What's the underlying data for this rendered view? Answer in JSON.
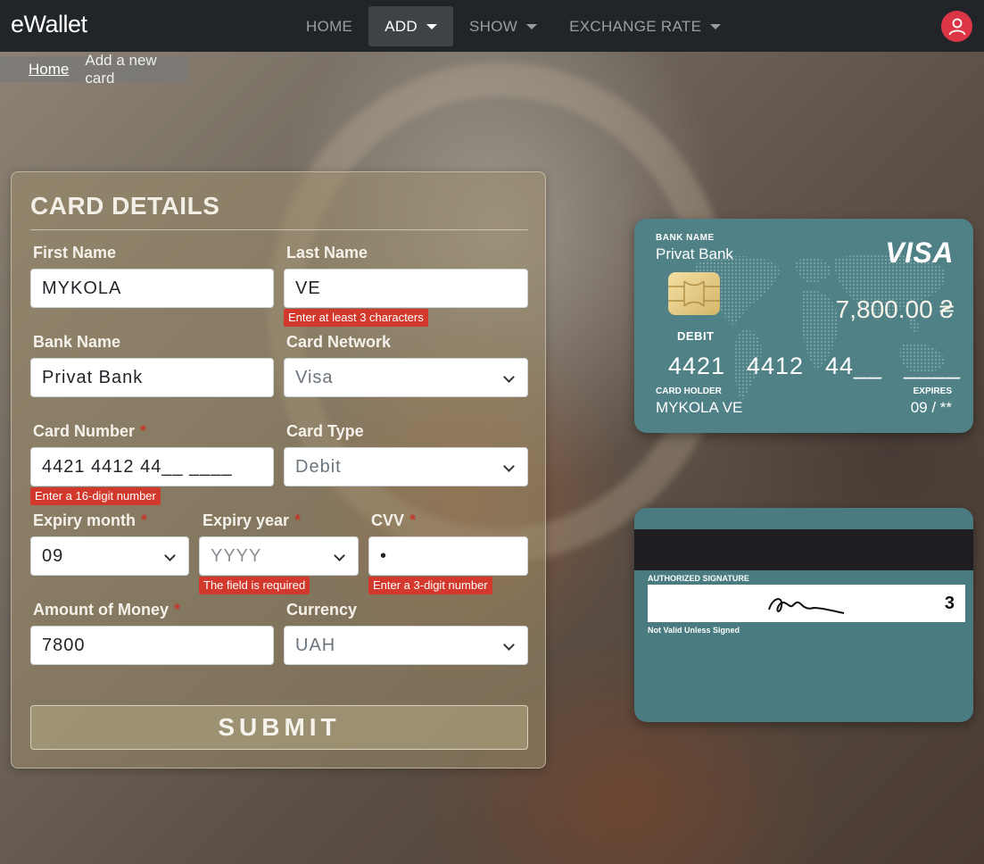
{
  "navbar": {
    "brand": "eWallet",
    "items": [
      {
        "label": "HOME",
        "dropdown": false,
        "active": false
      },
      {
        "label": "ADD",
        "dropdown": true,
        "active": true
      },
      {
        "label": "SHOW",
        "dropdown": true,
        "active": false
      },
      {
        "label": "EXCHANGE RATE",
        "dropdown": true,
        "active": false
      }
    ],
    "avatar_icon": "user-icon"
  },
  "breadcrumb": {
    "home": "Home",
    "current": "Add a new card"
  },
  "form": {
    "title": "CARD DETAILS",
    "first_name": {
      "label": "First Name",
      "value": "MYKOLA"
    },
    "last_name": {
      "label": "Last Name",
      "value": "VE",
      "error": "Enter at least 3 characters"
    },
    "bank_name": {
      "label": "Bank Name",
      "value": "Privat Bank"
    },
    "card_network": {
      "label": "Card Network",
      "value": "Visa"
    },
    "card_number": {
      "label": "Card Number",
      "required_mark": "*",
      "value": "4421 4412 44__ ____",
      "error": "Enter a 16-digit number"
    },
    "card_type": {
      "label": "Card Type",
      "value": "Debit"
    },
    "expiry_month": {
      "label": "Expiry month",
      "required_mark": "*",
      "value": "09"
    },
    "expiry_year": {
      "label": "Expiry year",
      "required_mark": "*",
      "placeholder": "YYYY",
      "error": "The field is required"
    },
    "cvv": {
      "label": "CVV",
      "required_mark": "*",
      "value": "•",
      "error": "Enter a 3-digit number"
    },
    "amount": {
      "label": "Amount of Money",
      "required_mark": "*",
      "value": "7800"
    },
    "currency": {
      "label": "Currency",
      "value": "UAH"
    },
    "submit": "SUBMIT"
  },
  "card_front": {
    "bank_name_label": "BANK NAME",
    "bank_name": "Privat Bank",
    "network": "VISA",
    "amount": "7,800.00 ₴",
    "type": "DEBIT",
    "number_groups": [
      "4421",
      "4412",
      "44__",
      "____"
    ],
    "holder_label": "CARD HOLDER",
    "holder": "MYKOLA VE",
    "expires_label": "EXPIRES",
    "expires": "09 / **"
  },
  "card_back": {
    "signature_label": "AUTHORIZED SIGNATURE",
    "cvv": "3",
    "note": "Not Valid Unless Signed"
  },
  "colors": {
    "navbar": "#212529",
    "error": "#d2382b",
    "avatar": "#dc3545",
    "card": "#4f8186"
  }
}
